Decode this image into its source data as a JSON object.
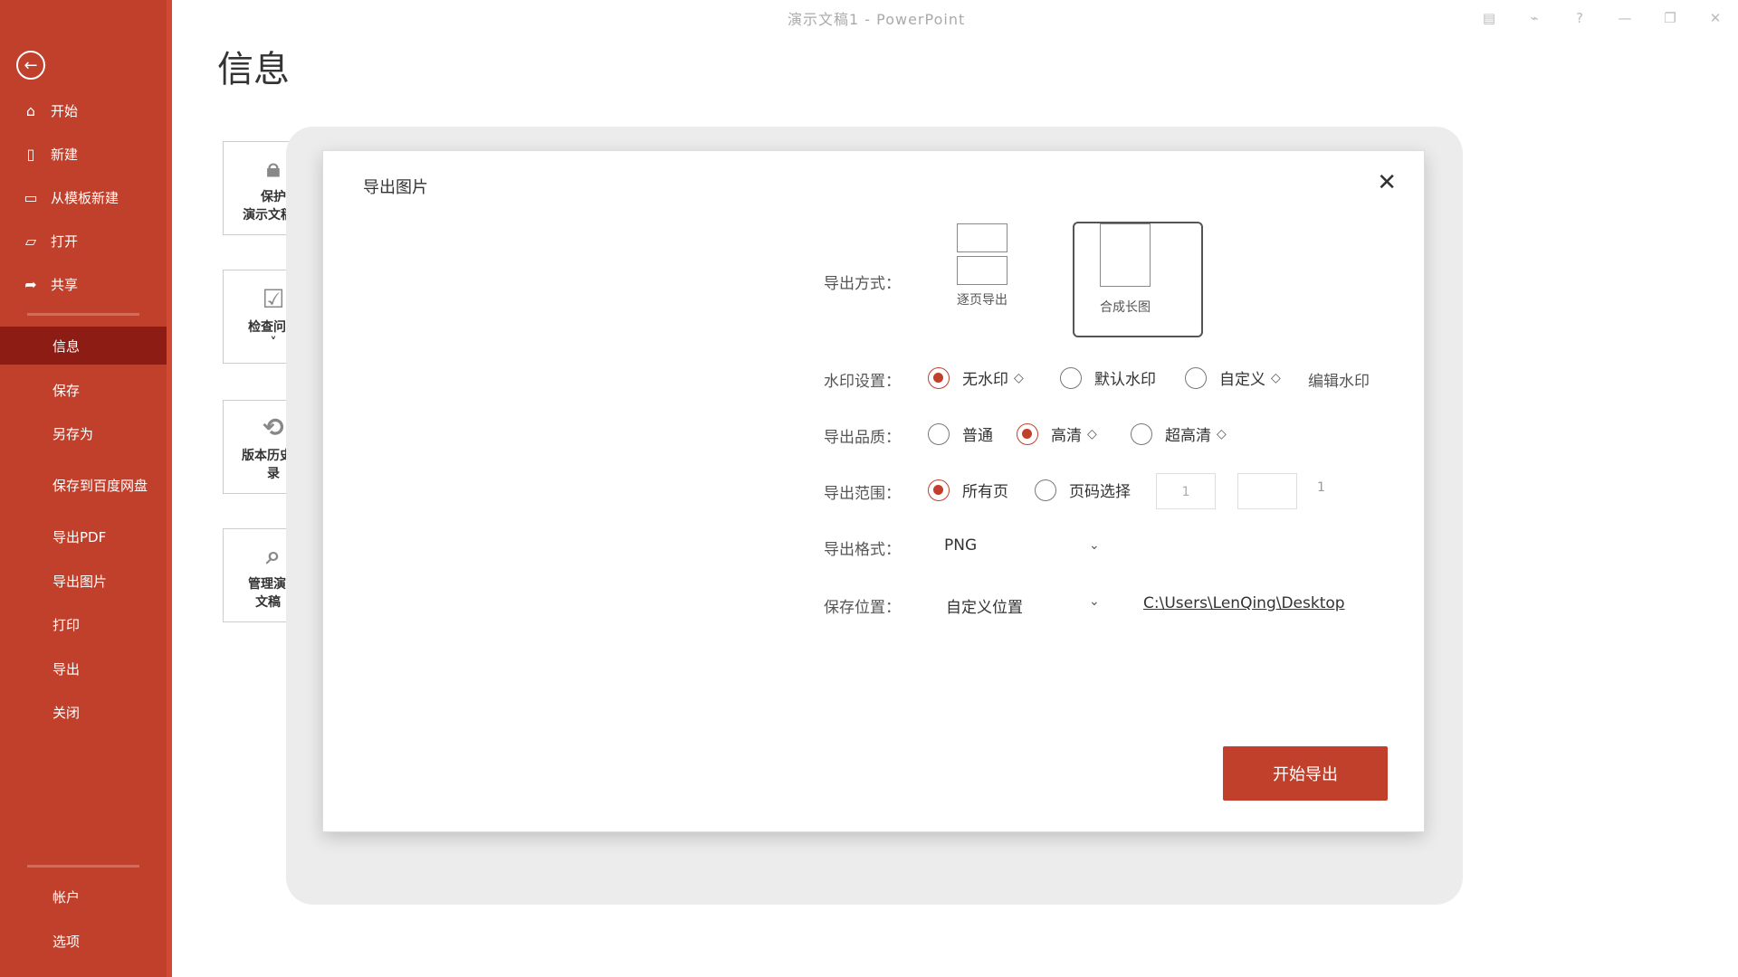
{
  "window": {
    "title": "演示文稿1 - PowerPoint",
    "controls": [
      "▤",
      "⌁",
      "?",
      "—",
      "❐",
      "✕"
    ]
  },
  "sidebar": {
    "items": [
      {
        "label": "开始",
        "icon": "home-icon"
      },
      {
        "label": "新建",
        "icon": "new-file-icon"
      },
      {
        "label": "从模板新建",
        "icon": "template-icon"
      },
      {
        "label": "打开",
        "icon": "folder-open-icon"
      },
      {
        "label": "共享",
        "icon": "share-icon"
      },
      {
        "label": "信息"
      },
      {
        "label": "保存"
      },
      {
        "label": "另存为"
      },
      {
        "label": "保存到百度网盘"
      },
      {
        "label": "导出PDF"
      },
      {
        "label": "导出图片"
      },
      {
        "label": "打印"
      },
      {
        "label": "导出"
      },
      {
        "label": "关闭"
      },
      {
        "label": "帐户"
      },
      {
        "label": "选项"
      }
    ],
    "active_color": "#8c1c14",
    "bg_color": "#c0402c"
  },
  "page": {
    "title": "信息"
  },
  "tools": [
    {
      "label": "保护\n演示文稿 ˅",
      "icon": "lock-icon"
    },
    {
      "label": "检查问题\n˅",
      "icon": "inspect-icon"
    },
    {
      "label": "版本历史记\n录",
      "icon": "history-icon"
    },
    {
      "label": "管理演示\n文稿 ˅",
      "icon": "manage-icon"
    }
  ],
  "dialog": {
    "title": "导出图片",
    "close": "✕",
    "labels": {
      "mode": "导出方式：",
      "watermark": "水印设置：",
      "quality": "导出品质：",
      "range": "导出范围：",
      "format": "导出格式：",
      "location": "保存位置："
    },
    "modes": [
      {
        "label": "逐页导出",
        "selected": false
      },
      {
        "label": "合成长图",
        "selected": true
      }
    ],
    "watermark_options": [
      {
        "label": "无水印",
        "premium": true,
        "selected": true
      },
      {
        "label": "默认水印",
        "premium": false,
        "selected": false
      },
      {
        "label": "自定义",
        "premium": true,
        "selected": false
      }
    ],
    "edit_watermark": "编辑水印",
    "quality_options": [
      {
        "label": "普通",
        "premium": false,
        "selected": false
      },
      {
        "label": "高清",
        "premium": true,
        "selected": true
      },
      {
        "label": "超高清",
        "premium": true,
        "selected": false
      }
    ],
    "range_options": [
      {
        "label": "所有页",
        "selected": true
      },
      {
        "label": "页码选择",
        "selected": false
      }
    ],
    "range_from": "1",
    "range_to": "",
    "range_total": "1",
    "format_value": "PNG",
    "location_value": "自定义位置",
    "location_path": "C:\\Users\\LenQing\\Desktop",
    "export_button": "开始导出",
    "accent": "#c0402c"
  }
}
